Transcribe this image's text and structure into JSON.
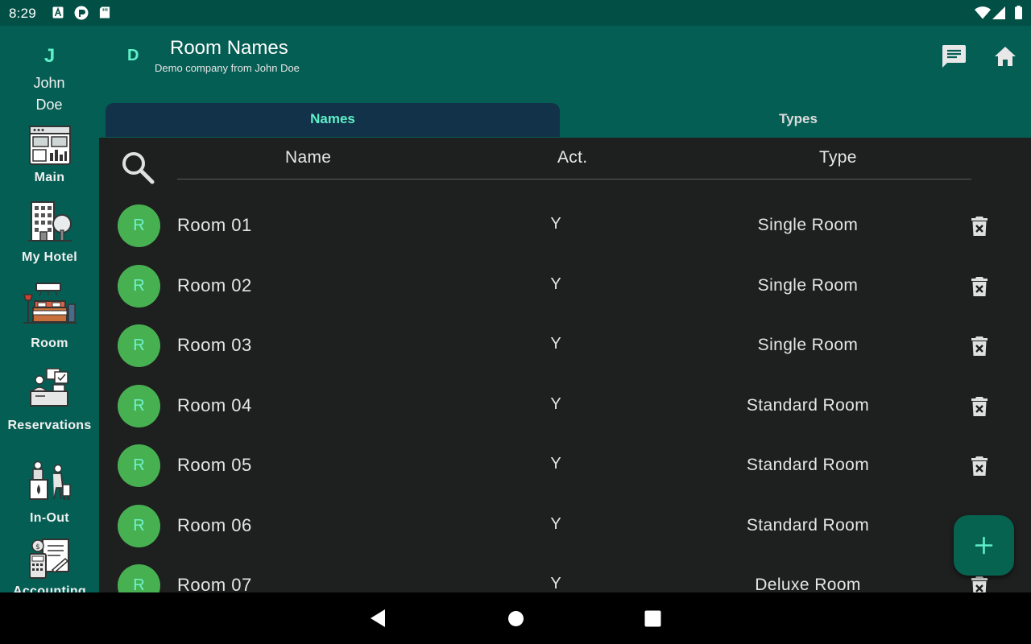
{
  "status_bar": {
    "time": "8:29",
    "left_icons": [
      "text-a-notification-icon",
      "app-notification-icon",
      "sd-card-icon"
    ],
    "right_icons": [
      "wifi-icon",
      "cellular-signal-icon",
      "battery-icon"
    ]
  },
  "rail": {
    "user_initial": "J",
    "user_name": "John Doe",
    "items": [
      {
        "label": "Main",
        "icon": "dashboard-icon"
      },
      {
        "label": "My Hotel",
        "icon": "hotel-building-icon"
      },
      {
        "label": "Room",
        "icon": "hotel-room-icon"
      },
      {
        "label": "Reservations",
        "icon": "reception-desk-icon"
      },
      {
        "label": "In-Out",
        "icon": "check-in-out-icon"
      },
      {
        "label": "Accounting",
        "icon": "accounting-icon"
      }
    ]
  },
  "header": {
    "company_initial": "D",
    "title": "Room Names",
    "subtitle": "Demo company from John Doe",
    "actions": [
      "chat-icon",
      "home-icon"
    ]
  },
  "tabs": [
    {
      "label": "Names",
      "active": true
    },
    {
      "label": "Types",
      "active": false
    }
  ],
  "table": {
    "columns": {
      "name": "Name",
      "active": "Act.",
      "type": "Type"
    },
    "rows": [
      {
        "avatar": "R",
        "name": "Room 01",
        "active": "Y",
        "type": "Single Room"
      },
      {
        "avatar": "R",
        "name": "Room 02",
        "active": "Y",
        "type": "Single Room"
      },
      {
        "avatar": "R",
        "name": "Room 03",
        "active": "Y",
        "type": "Single Room"
      },
      {
        "avatar": "R",
        "name": "Room 04",
        "active": "Y",
        "type": "Standard Room"
      },
      {
        "avatar": "R",
        "name": "Room 05",
        "active": "Y",
        "type": "Standard Room"
      },
      {
        "avatar": "R",
        "name": "Room 06",
        "active": "Y",
        "type": "Standard Room"
      },
      {
        "avatar": "R",
        "name": "Room 07",
        "active": "Y",
        "type": "Deluxe Room"
      }
    ]
  },
  "fab": {
    "icon": "plus-icon"
  },
  "nav_bar": {
    "buttons": [
      "back-icon",
      "home-circle-icon",
      "recents-icon"
    ]
  },
  "colors": {
    "status_bar": "#024f45",
    "primary": "#055e54",
    "accent": "#5ff0c8",
    "active_tab": "#12324a",
    "avatar": "#47b152",
    "fab": "#066350",
    "background": "#1e1f1f"
  }
}
